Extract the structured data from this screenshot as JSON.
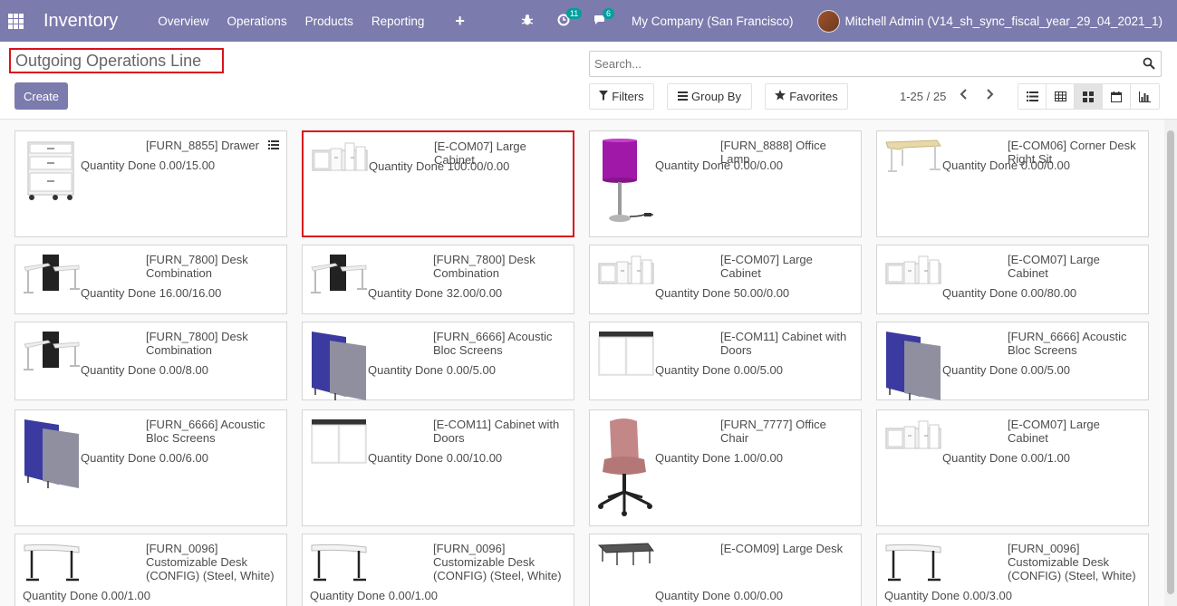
{
  "navbar": {
    "app_name": "Inventory",
    "menu": [
      "Overview",
      "Operations",
      "Products",
      "Reporting"
    ],
    "activity_count": "11",
    "message_count": "6",
    "company": "My Company (San Francisco)",
    "user": "Mitchell Admin (V14_sh_sync_fiscal_year_29_04_2021_1)",
    "color": "#7c7bad"
  },
  "control_panel": {
    "title": "Outgoing Operations Line",
    "create_label": "Create",
    "search_placeholder": "Search...",
    "filters_label": "Filters",
    "groupby_label": "Group By",
    "favorites_label": "Favorites",
    "pager": "1-25 / 25"
  },
  "cards": [
    {
      "name": "[FURN_8855] Drawer",
      "qty": "Quantity Done 0.00/15.00",
      "icon": "drawer"
    },
    {
      "name": "[E-COM07] Large Cabinet",
      "qty": "Quantity Done 100.00/0.00",
      "icon": "cabinet"
    },
    {
      "name": "[FURN_8888] Office Lamp",
      "qty": "Quantity Done 0.00/0.00",
      "icon": "lamp"
    },
    {
      "name": "[E-COM06] Corner Desk Right Sit",
      "qty": "Quantity Done 0.00/0.00",
      "icon": "corner-desk"
    },
    {
      "name": "[FURN_7800] Desk Combination",
      "qty": "Quantity Done 16.00/16.00",
      "icon": "desk-combo"
    },
    {
      "name": "[FURN_7800] Desk Combination",
      "qty": "Quantity Done 32.00/0.00",
      "icon": "desk-combo"
    },
    {
      "name": "[E-COM07] Large Cabinet",
      "qty": "Quantity Done 50.00/0.00",
      "icon": "cabinet"
    },
    {
      "name": "[E-COM07] Large Cabinet",
      "qty": "Quantity Done 0.00/80.00",
      "icon": "cabinet"
    },
    {
      "name": "[FURN_7800] Desk Combination",
      "qty": "Quantity Done 0.00/8.00",
      "icon": "desk-combo"
    },
    {
      "name": "[FURN_6666] Acoustic Bloc Screens",
      "qty": "Quantity Done 0.00/5.00",
      "icon": "screens"
    },
    {
      "name": "[E-COM11] Cabinet with Doors",
      "qty": "Quantity Done 0.00/5.00",
      "icon": "cabinet-doors"
    },
    {
      "name": "[FURN_6666] Acoustic Bloc Screens",
      "qty": "Quantity Done 0.00/5.00",
      "icon": "screens"
    },
    {
      "name": "[FURN_6666] Acoustic Bloc Screens",
      "qty": "Quantity Done 0.00/6.00",
      "icon": "screens"
    },
    {
      "name": "[E-COM11] Cabinet with Doors",
      "qty": "Quantity Done 0.00/10.00",
      "icon": "cabinet-doors"
    },
    {
      "name": "[FURN_7777] Office Chair",
      "qty": "Quantity Done 1.00/0.00",
      "icon": "chair"
    },
    {
      "name": "[E-COM07] Large Cabinet",
      "qty": "Quantity Done 0.00/1.00",
      "icon": "cabinet"
    },
    {
      "name": "[FURN_0096] Customizable Desk (CONFIG) (Steel, White)",
      "qty": "Quantity Done 0.00/1.00",
      "icon": "desk"
    },
    {
      "name": "[FURN_0096] Customizable Desk (CONFIG) (Steel, White)",
      "qty": "Quantity Done 0.00/1.00",
      "icon": "desk"
    },
    {
      "name": "[E-COM09] Large Desk",
      "qty": "Quantity Done 0.00/0.00",
      "icon": "large-desk"
    },
    {
      "name": "[FURN_0096] Customizable Desk (CONFIG) (Steel, White)",
      "qty": "Quantity Done 0.00/3.00",
      "icon": "desk"
    }
  ]
}
